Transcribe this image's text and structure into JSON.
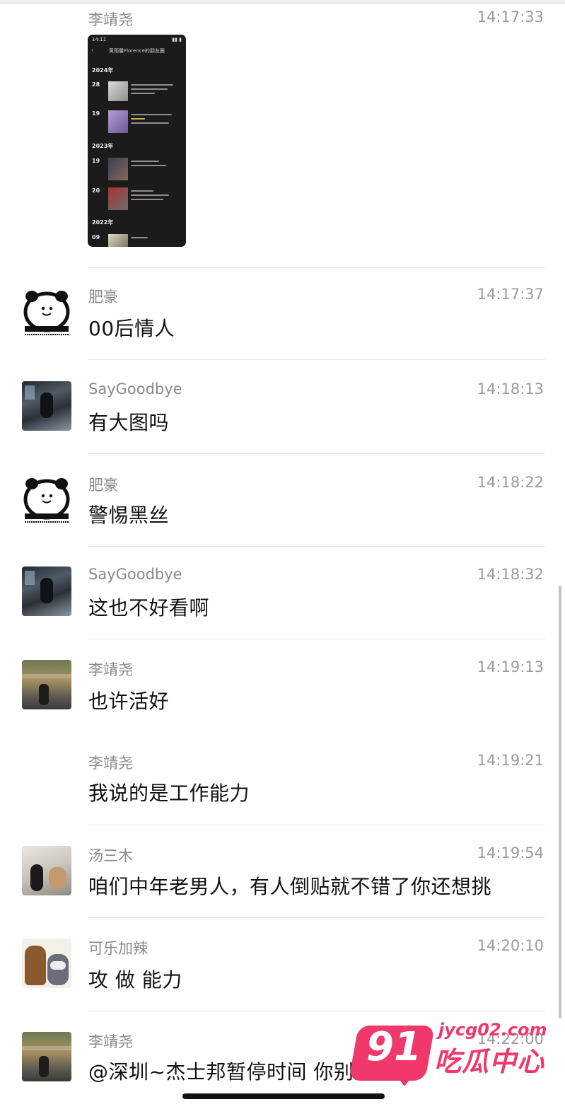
{
  "messages": [
    {
      "sender": "李靖尧",
      "time": "14:17:33",
      "type": "image",
      "thumbnail": {
        "status_time": "14:11",
        "title": "黄雨馨Florence的朋友圈",
        "years": [
          "2024年",
          "2023年",
          "2022年"
        ],
        "days": [
          "28",
          "19",
          "19",
          "20",
          "09"
        ],
        "captions": [
          "从诺特到布格尔",
          "感谢各位的关心与支持",
          "我的红唇",
          "毕业快乐",
          "天下有"
        ]
      }
    },
    {
      "sender": "肥豪",
      "time": "14:17:37",
      "text": "00后情人"
    },
    {
      "sender": "SayGoodbye",
      "time": "14:18:13",
      "text": "有大图吗"
    },
    {
      "sender": "肥豪",
      "time": "14:18:22",
      "text": "警惕黑丝"
    },
    {
      "sender": "SayGoodbye",
      "time": "14:18:32",
      "text": "这也不好看啊"
    },
    {
      "sender": "李靖尧",
      "time": "14:19:13",
      "text": "也许活好"
    },
    {
      "sender": "李靖尧",
      "time": "14:19:21",
      "text": "我说的是工作能力"
    },
    {
      "sender": "汤三木",
      "time": "14:19:54",
      "text": "咱们中年老男人，有人倒贴就不错了你还想挑"
    },
    {
      "sender": "可乐加辣",
      "time": "14:20:10",
      "text": "攻 做 能力"
    },
    {
      "sender": "李靖尧",
      "time": "14:22:00",
      "text": "@深圳~杰士邦暂停时间 你别这解"
    }
  ],
  "watermark": {
    "number": "91",
    "url": "jycg02.com",
    "name": "吃瓜中心",
    "color": "#f0386b"
  }
}
